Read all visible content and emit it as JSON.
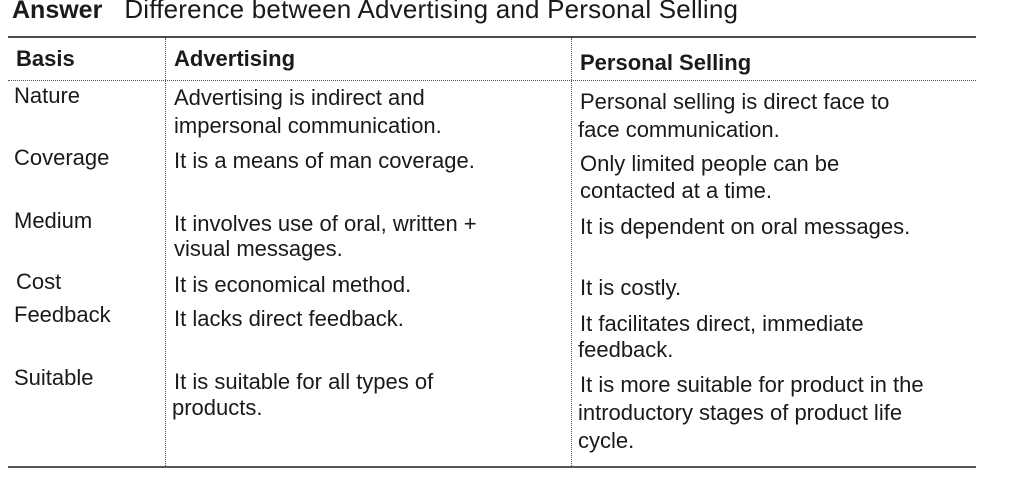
{
  "heading": {
    "answer_label": "Answer",
    "title": "Difference between Advertising and Personal Selling"
  },
  "table": {
    "headers": [
      "Basis",
      "Advertising",
      "Personal Selling"
    ],
    "rows": [
      {
        "basis": "Nature",
        "advertising": [
          "Advertising is indirect and",
          "impersonal communication."
        ],
        "personal_selling": [
          "Personal selling is direct face to",
          "face communication."
        ]
      },
      {
        "basis": "Coverage",
        "advertising": [
          "It is a means of man coverage."
        ],
        "personal_selling": [
          "Only limited people can be",
          "contacted at a time."
        ]
      },
      {
        "basis": "Medium",
        "advertising": [
          "It involves use of oral, written +",
          "visual messages."
        ],
        "personal_selling": [
          "It is dependent on oral messages."
        ]
      },
      {
        "basis": "Cost",
        "advertising": [
          "It is economical method."
        ],
        "personal_selling": [
          "It is costly."
        ]
      },
      {
        "basis": "Feedback",
        "advertising": [
          "It lacks direct feedback."
        ],
        "personal_selling": [
          "It facilitates direct, immediate",
          "feedback."
        ]
      },
      {
        "basis": "Suitable",
        "advertising": [
          "It is suitable for all types of",
          "products."
        ],
        "personal_selling": [
          "It is more suitable for product in the",
          "introductory stages of product life",
          "cycle."
        ]
      }
    ]
  }
}
